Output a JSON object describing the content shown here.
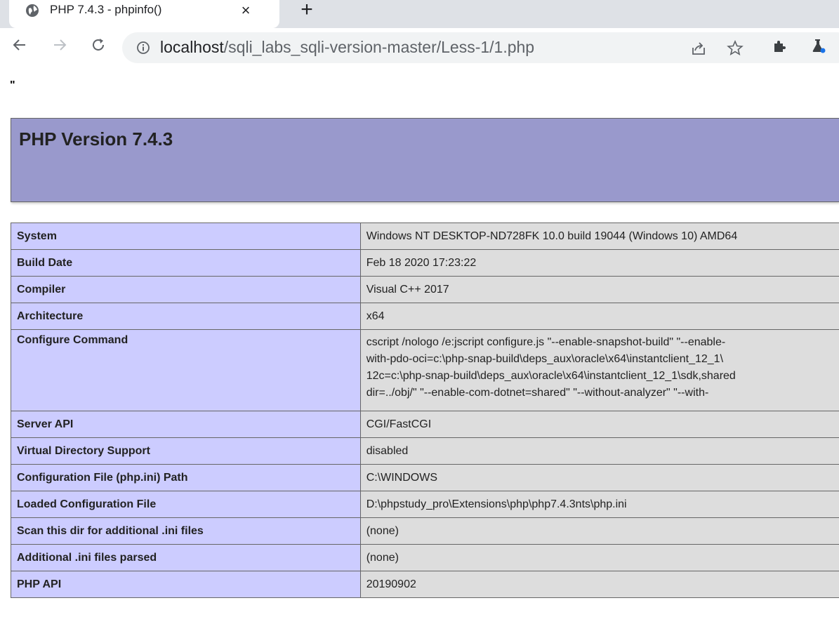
{
  "browser": {
    "tab_title": "PHP 7.4.3 - phpinfo()",
    "tab_close": "×",
    "new_tab": "+",
    "url_host": "localhost",
    "url_path": "/sqli_labs_sqli-version-master/Less-1/1.php",
    "icons": {
      "globe": "globe-icon",
      "close": "close-icon",
      "new_tab": "plus-icon",
      "back": "arrow-left-icon",
      "forward": "arrow-right-icon",
      "reload": "reload-icon",
      "info": "info-icon",
      "share": "share-icon",
      "bookmark": "star-icon",
      "extensions": "puzzle-icon",
      "labs": "flask-icon"
    }
  },
  "page": {
    "stray_text": "\"",
    "header_title": "PHP Version 7.4.3",
    "rows": [
      {
        "label": "System",
        "value": "Windows NT DESKTOP-ND728FK 10.0 build 19044 (Windows 10) AMD64"
      },
      {
        "label": "Build Date",
        "value": "Feb 18 2020 17:23:22"
      },
      {
        "label": "Compiler",
        "value": "Visual C++ 2017"
      },
      {
        "label": "Architecture",
        "value": "x64"
      },
      {
        "label": "Configure Command",
        "value_lines": [
          "cscript /nologo /e:jscript configure.js \"--enable-snapshot-build\" \"--enable-",
          "with-pdo-oci=c:\\php-snap-build\\deps_aux\\oracle\\x64\\instantclient_12_1\\",
          "12c=c:\\php-snap-build\\deps_aux\\oracle\\x64\\instantclient_12_1\\sdk,shared",
          "dir=../obj/\" \"--enable-com-dotnet=shared\" \"--without-analyzer\" \"--with-"
        ]
      },
      {
        "label": "Server API",
        "value": "CGI/FastCGI"
      },
      {
        "label": "Virtual Directory Support",
        "value": "disabled"
      },
      {
        "label": "Configuration File (php.ini) Path",
        "value": "C:\\WINDOWS"
      },
      {
        "label": "Loaded Configuration File",
        "value": "D:\\phpstudy_pro\\Extensions\\php\\php7.4.3nts\\php.ini"
      },
      {
        "label": "Scan this dir for additional .ini files",
        "value": "(none)"
      },
      {
        "label": "Additional .ini files parsed",
        "value": "(none)"
      },
      {
        "label": "PHP API",
        "value": "20190902"
      }
    ]
  },
  "colors": {
    "header_bg": "#9999cc",
    "label_bg": "#ccccff",
    "value_bg": "#dddddd",
    "tab_strip_bg": "#dee1e6",
    "omnibox_bg": "#f1f3f4"
  }
}
